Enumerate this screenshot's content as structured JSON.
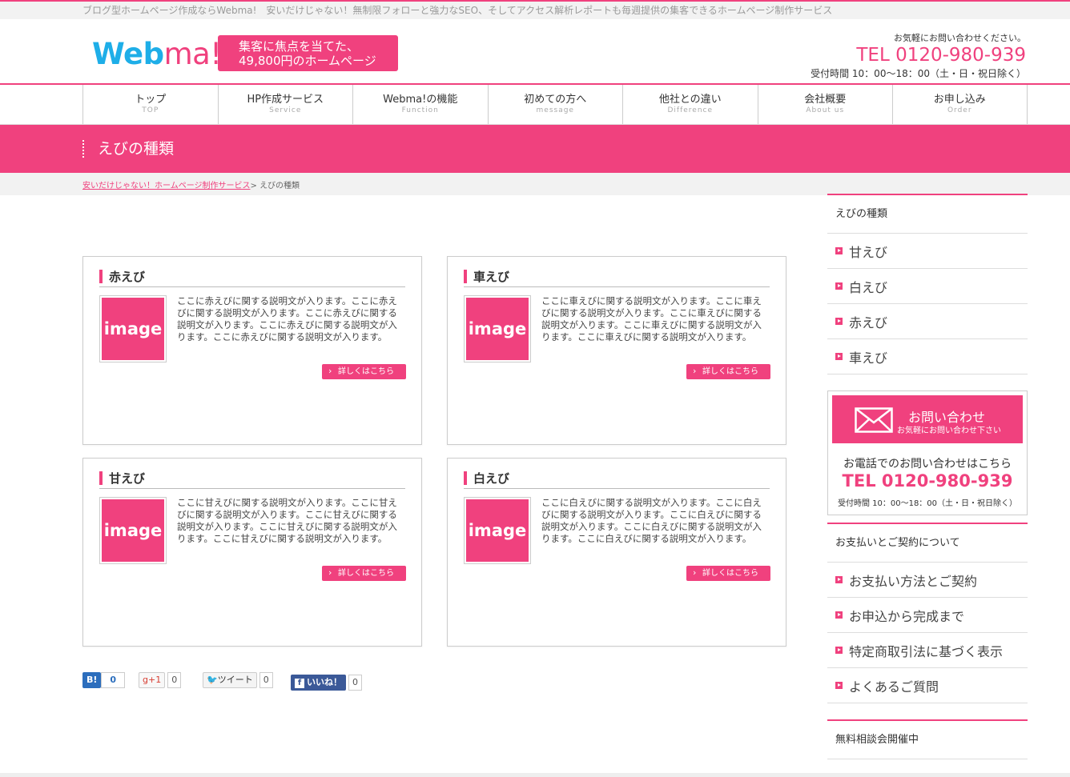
{
  "topbar": {
    "text": "ブログ型ホームページ作成ならWebma!　安いだけじゃない！無制限フォローと強力なSEO、そしてアクセス解析レポートも毎週提供の集客できるホームページ制作サービス"
  },
  "header": {
    "logo_a": "Web",
    "logo_b": "ma!",
    "catch_1": "集客に焦点を当てた、",
    "catch_2": "49,800円のホームページ",
    "contact_note": "お気軽にお問い合わせください。",
    "tel": "TEL 0120-980-939",
    "hours": "受付時間 10：00～18：00（土・日・祝日除く）"
  },
  "nav": [
    {
      "jp": "トップ",
      "en": "TOP"
    },
    {
      "jp": "HP作成サービス",
      "en": "Service"
    },
    {
      "jp": "Webma!の機能",
      "en": "Function"
    },
    {
      "jp": "初めての方へ",
      "en": "message"
    },
    {
      "jp": "他社との違い",
      "en": "Difference"
    },
    {
      "jp": "会社概要",
      "en": "About us"
    },
    {
      "jp": "お申し込み",
      "en": "Order"
    }
  ],
  "page_title": "えびの種類",
  "breadcrumb": {
    "home": "安いだけじゃない！ホームページ制作サービス",
    "sep": "> ",
    "current": "えびの種類"
  },
  "cards": [
    {
      "title": "赤えび",
      "image": "image",
      "desc": "ここに赤えびに関する説明文が入ります。ここに赤えびに関する説明文が入ります。ここに赤えびに関する説明文が入ります。ここに赤えびに関する説明文が入ります。ここに赤えびに関する説明文が入ります。",
      "more": "詳しくはこちら"
    },
    {
      "title": "車えび",
      "image": "image",
      "desc": "ここに車えびに関する説明文が入ります。ここに車えびに関する説明文が入ります。ここに車えびに関する説明文が入ります。ここに車えびに関する説明文が入ります。ここに車えびに関する説明文が入ります。",
      "more": "詳しくはこちら"
    },
    {
      "title": "甘えび",
      "image": "image",
      "desc": "ここに甘えびに関する説明文が入ります。ここに甘えびに関する説明文が入ります。ここに甘えびに関する説明文が入ります。ここに甘えびに関する説明文が入ります。ここに甘えびに関する説明文が入ります。",
      "more": "詳しくはこちら"
    },
    {
      "title": "白えび",
      "image": "image",
      "desc": "ここに白えびに関する説明文が入ります。ここに白えびに関する説明文が入ります。ここに白えびに関する説明文が入ります。ここに白えびに関する説明文が入ります。ここに白えびに関する説明文が入ります。",
      "more": "詳しくはこちら"
    }
  ],
  "social": {
    "hatena": "B!",
    "hatena_count": "0",
    "gplus": "g+1",
    "gplus_count": "0",
    "tweet": "ツイート",
    "tweet_count": "0",
    "like": "いいね！",
    "like_count": "0"
  },
  "sidebar": {
    "cat_head": "えびの種類",
    "cat_items": [
      "甘えび",
      "白えび",
      "赤えび",
      "車えび"
    ],
    "contact_btn": "お問い合わせ",
    "contact_btn_sub": "お気軽にお問い合わせ下さい",
    "contact_phone_note": "お電話でのお問い合わせはこちら",
    "contact_tel": "TEL 0120-980-939",
    "contact_hours": "受付時間 10：00～18：00（土・日・祝日除く）",
    "pay_head": "お支払いとご契約について",
    "pay_items": [
      "お支払い方法とご契約",
      "お申込から完成まで",
      "特定商取引法に基づく表示",
      "よくあるご質問"
    ],
    "free_head": "無料相談会開催中"
  },
  "colors": {
    "accent": "#f0417e",
    "logo_blue": "#1eaee8"
  }
}
